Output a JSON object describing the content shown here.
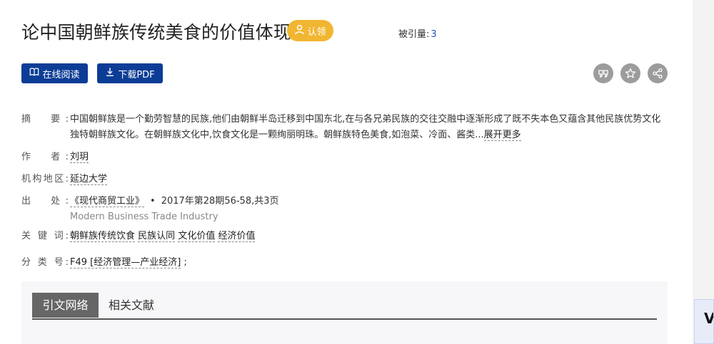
{
  "article": {
    "title": "论中国朝鲜族传统美食的价值体现",
    "claim_label": "认领",
    "citation_label": "被引量:",
    "citation_count": "3"
  },
  "actions": {
    "read_online_label": "在线阅读",
    "download_pdf_label": "下载PDF",
    "icons": [
      "quote-icon",
      "star-icon",
      "share-icon"
    ]
  },
  "meta": {
    "abstract_label": "摘　要:",
    "abstract_text": "中国朝鲜族是一个勤劳智慧的民族,他们由朝鲜半岛迁移到中国东北,在与各兄弟民族的交往交融中逐渐形成了既不失本色又蕴含其他民族优势文化独特朝鲜族文化。在朝鲜族文化中,饮食文化是一颗绚丽明珠。朝鲜族特色美食,如泡菜、冷面、酱类...",
    "expand_label": "展开更多",
    "author_label": "作　者:",
    "author": "刘玥",
    "institution_label": "机构地区:",
    "institution": "延边大学",
    "source_label": "出　处:",
    "journal": "《现代商贸工业》",
    "issue": "2017年第28期56-58,共3页",
    "journal_en": "Modern Business Trade Industry",
    "keywords_label": "关 键 词:",
    "keywords": [
      "朝鲜族传统饮食",
      "民族认同",
      "文化价值",
      "经济价值"
    ],
    "classification_label": "分 类 号:",
    "classification": "F49 [经济管理—产业经济]",
    "classification_suffix": ";"
  },
  "tabs": [
    "引文网络",
    "相关文献"
  ],
  "colors": {
    "brand_blue": "#0c3d96",
    "claim_yellow": "#f1b631",
    "icon_gray": "#9c9c9c",
    "link_blue": "#2456b7"
  }
}
